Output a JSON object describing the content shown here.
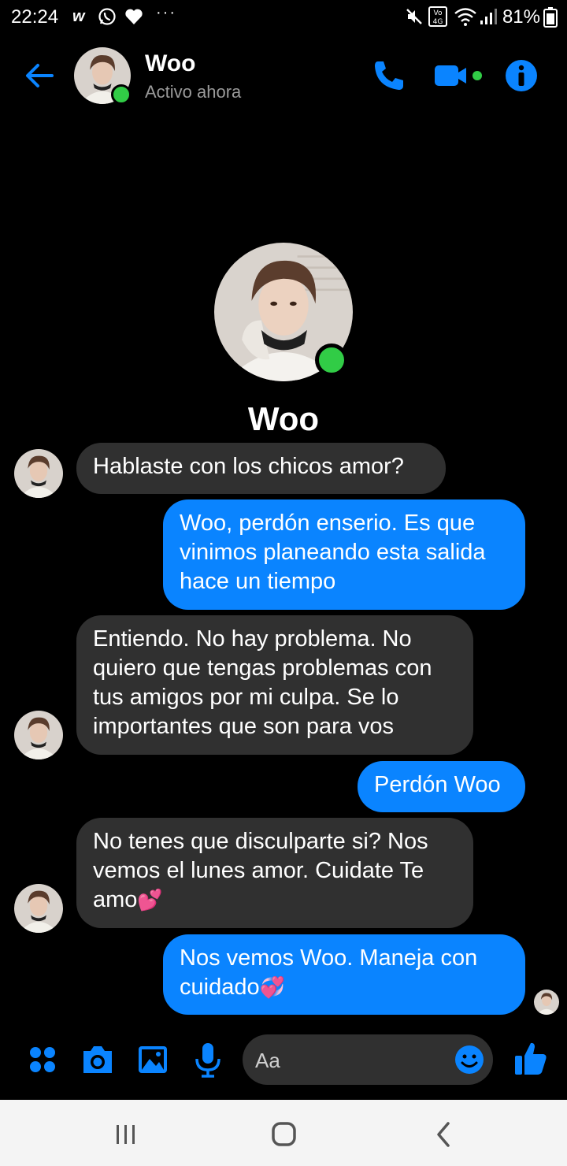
{
  "status_bar": {
    "time": "22:24",
    "left_icons": [
      "w-icon",
      "whatsapp-icon",
      "heart-icon",
      "more-dots-icon"
    ],
    "right_icons": [
      "mute-icon",
      "volte-4g-icon",
      "wifi-icon",
      "signal-icon"
    ],
    "battery": "81%"
  },
  "header": {
    "name": "Woo",
    "status": "Activo ahora",
    "online": true
  },
  "profile": {
    "name": "Woo",
    "online": true
  },
  "messages": [
    {
      "from": "them",
      "text": "Hablaste con los chicos amor?"
    },
    {
      "from": "me",
      "text": "Woo, perdón enserio. Es que vinimos planeando esta salida hace un tiempo"
    },
    {
      "from": "them",
      "text": "Entiendo. No hay problema. No quiero que tengas problemas con tus amigos por mi culpa. Se lo importantes que son para vos"
    },
    {
      "from": "me",
      "text": "Perdón Woo"
    },
    {
      "from": "them",
      "text": "No tenes que disculparte si? Nos vemos el lunes amor. Cuidate Te amo",
      "emoji": "💕"
    },
    {
      "from": "me",
      "text": "Nos vemos Woo. Maneja con cuidado",
      "emoji": "💞"
    }
  ],
  "composer": {
    "placeholder": "Aa"
  },
  "colors": {
    "accent": "#0a84ff",
    "incoming_bubble": "#303030",
    "online": "#31cc46",
    "background": "#000000"
  }
}
